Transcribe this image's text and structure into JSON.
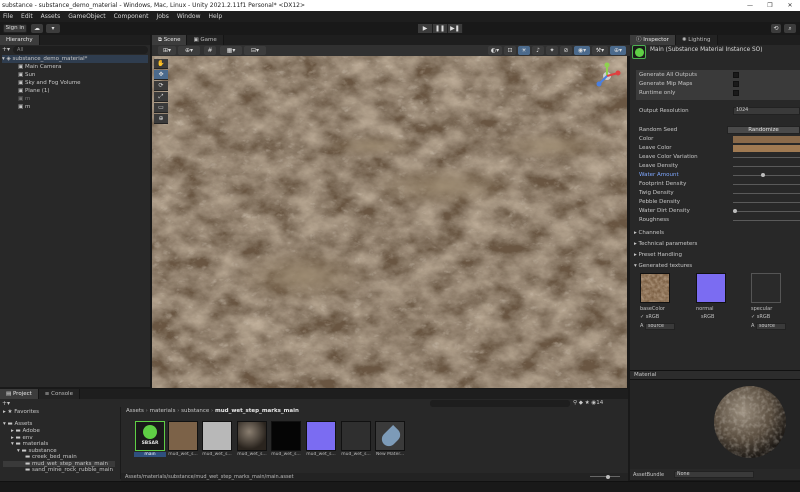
{
  "window": {
    "title": "substance - substance_demo_material - Windows, Mac, Linux - Unity 2021.2.11f1 Personal* <DX12>",
    "controls": [
      "—",
      "❐",
      "✕"
    ]
  },
  "menu": [
    "File",
    "Edit",
    "Assets",
    "GameObject",
    "Component",
    "Jobs",
    "Window",
    "Help"
  ],
  "toolbar": {
    "signin": "Sign in",
    "play": [
      "▶",
      "❚❚",
      "▶❚"
    ]
  },
  "hierarchy": {
    "tab": "Hierarchy",
    "search_placeholder": "All",
    "scene": "substance_demo_material*",
    "items": [
      "Main Camera",
      "Sun",
      "Sky and Fog Volume",
      "Plane (1)",
      "m",
      "m"
    ]
  },
  "scene_view": {
    "tabs": [
      "Scene",
      "Game"
    ],
    "tools": [
      "✋",
      "✥",
      "⟳",
      "⤢",
      "▭",
      "⊕"
    ]
  },
  "inspector": {
    "tabs": [
      "Inspector",
      "Lighting"
    ],
    "header": "Main (Substance Material Instance SO)",
    "checkboxes": [
      "Generate All Outputs",
      "Generate Mip Maps",
      "Runtime only"
    ],
    "output_resolution_label": "Output Resolution",
    "output_resolution_value": "1024",
    "random_seed_label": "Random Seed",
    "randomize_button": "Randomize",
    "params": [
      "Color",
      "Leave Color",
      "Leave Color Variation",
      "Leave Density",
      "Water Amount",
      "Footprint Density",
      "Twig Density",
      "Pebble Density",
      "Water Dirt Density",
      "Roughness"
    ],
    "foldouts": [
      "Channels",
      "Technical parameters",
      "Preset Handling",
      "Generated textures"
    ],
    "textures": [
      {
        "name": "baseColor",
        "srgb": "sRGB",
        "source": "source"
      },
      {
        "name": "normal",
        "srgb": "sRGB",
        "source": ""
      },
      {
        "name": "specular",
        "srgb": "sRGB",
        "source": "source"
      }
    ],
    "material_label": "Material",
    "assetbundle_label": "AssetBundle",
    "assetbundle_value": "None",
    "colors": {
      "color_swatch": "#8a6a4a",
      "leave_swatch": "#a07a52",
      "water_amount_label": "#7fa8ff"
    }
  },
  "project": {
    "tabs": [
      "Project",
      "Console"
    ],
    "favorites": "Favorites",
    "tree": [
      "Assets",
      "Adobe",
      "env",
      "materials",
      "substance",
      "creek_bed_main",
      "mud_wet_step_marks_main",
      "sand_mine_rock_rubble_main"
    ],
    "breadcrumb": [
      "Assets",
      "materials",
      "substance",
      "mud_wet_step_marks_main"
    ],
    "assets": [
      "main",
      "mud_wet_s...",
      "mud_wet_s...",
      "mud_wet_s...",
      "mud_wet_s...",
      "mud_wet_s...",
      "mud_wet_s...",
      "New Mater..."
    ],
    "sbsar_badge": "SBSAR",
    "count": "14",
    "status_path": "Assets/materials/substance/mud_wet_step_marks_main/main.asset"
  }
}
